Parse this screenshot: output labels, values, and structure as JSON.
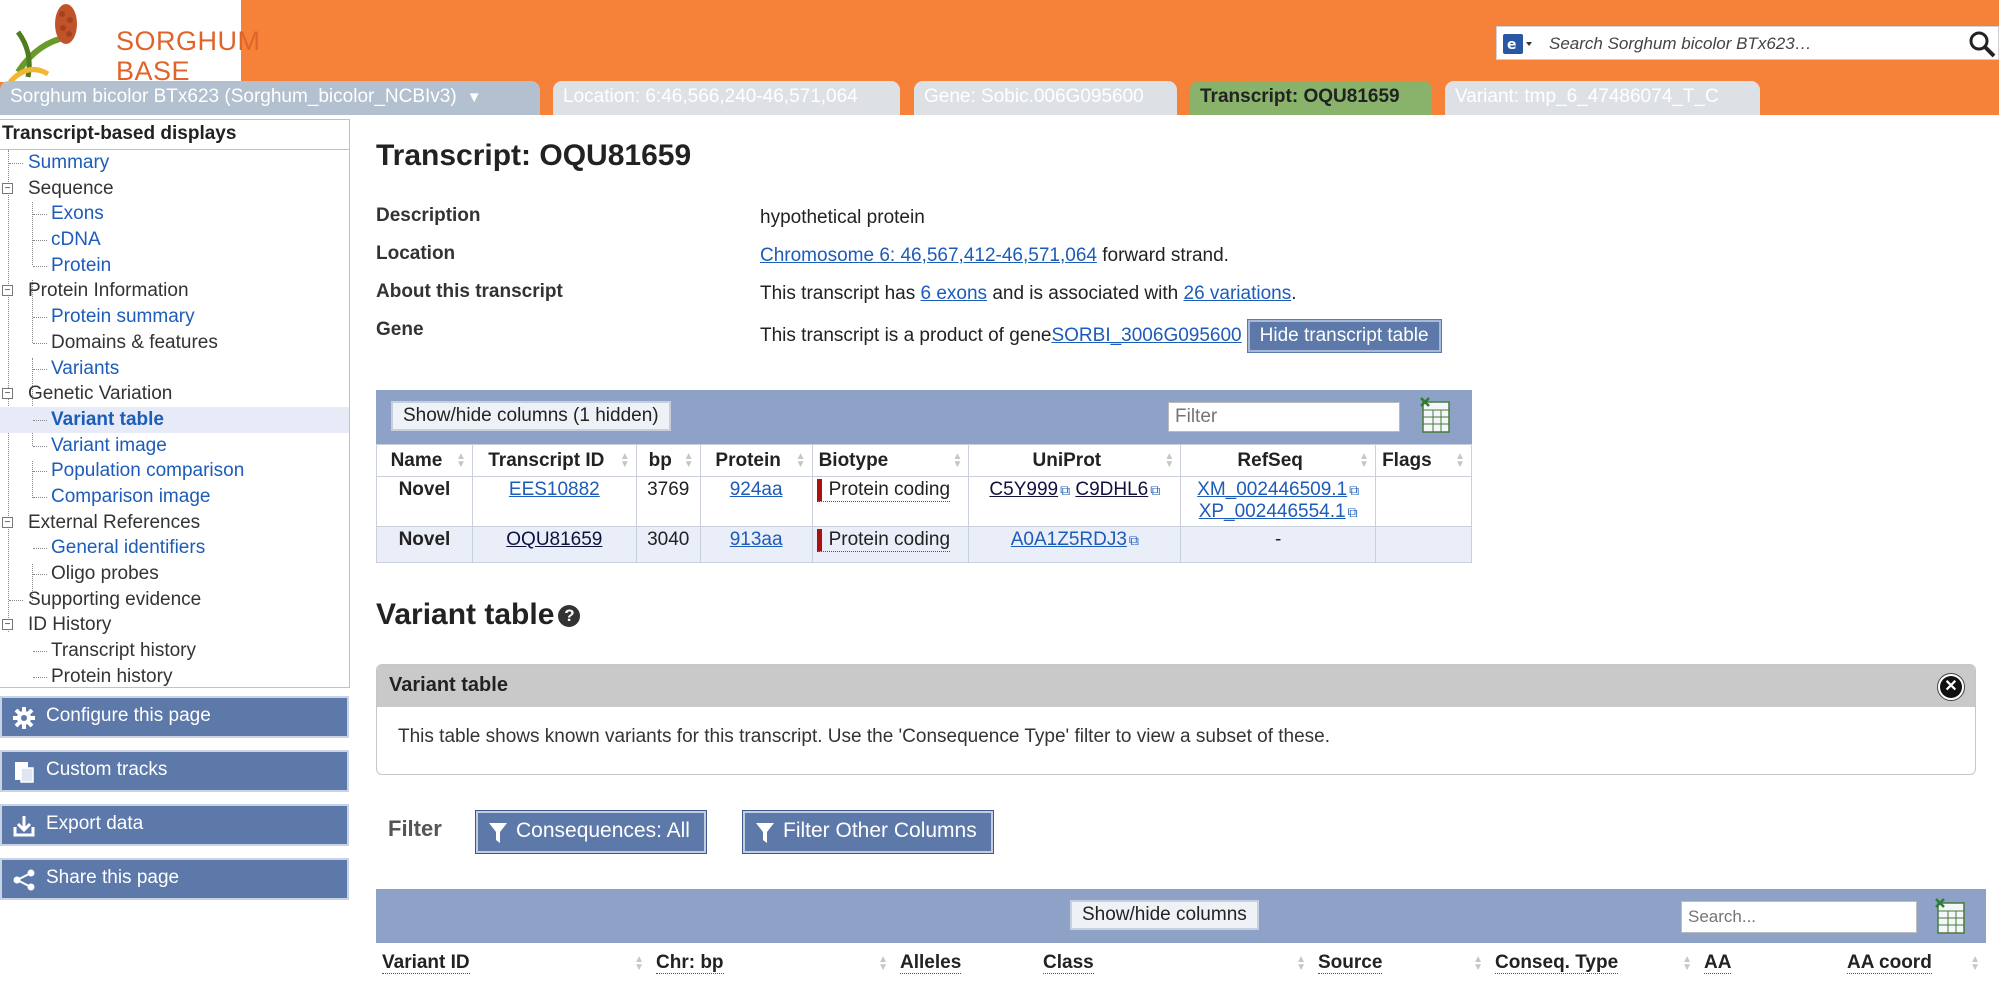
{
  "logo": {
    "line1": "SORGHUM",
    "line2": "BASE"
  },
  "search": {
    "placeholder": "Search Sorghum bicolor BTx623…"
  },
  "tabs": [
    {
      "label": "Sorghum bicolor BTx623 (Sorghum_bicolor_NCBIv3)",
      "caret": "▼"
    },
    {
      "label": "Location: 6:46,566,240-46,571,064"
    },
    {
      "label": "Gene: Sobic.006G095600"
    },
    {
      "label": "Transcript: OQU81659"
    },
    {
      "label": "Variant: tmp_6_47486074_T_C"
    }
  ],
  "sidebar": {
    "header": "Transcript-based displays",
    "tree": [
      {
        "label": "Summary"
      },
      {
        "label": "Sequence",
        "toggle": "−"
      },
      {
        "label": "Exons"
      },
      {
        "label": "cDNA"
      },
      {
        "label": "Protein"
      },
      {
        "label": "Protein Information",
        "toggle": "−"
      },
      {
        "label": "Protein summary"
      },
      {
        "label": "Domains & features"
      },
      {
        "label": "Variants"
      },
      {
        "label": "Genetic Variation",
        "toggle": "−"
      },
      {
        "label": "Variant table"
      },
      {
        "label": "Variant image"
      },
      {
        "label": "Population comparison"
      },
      {
        "label": "Comparison image"
      },
      {
        "label": "External References",
        "toggle": "−"
      },
      {
        "label": "General identifiers"
      },
      {
        "label": "Oligo probes"
      },
      {
        "label": "Supporting evidence"
      },
      {
        "label": "ID History",
        "toggle": "−"
      },
      {
        "label": "Transcript history"
      },
      {
        "label": "Protein history"
      }
    ],
    "buttons": {
      "configure": "Configure this page",
      "custom_tracks": "Custom tracks",
      "export": "Export data",
      "share": "Share this page"
    }
  },
  "main": {
    "title": "Transcript: OQU81659",
    "description": {
      "label": "Description",
      "value": "hypothetical protein"
    },
    "location": {
      "label": "Location",
      "link": "Chromosome 6: 46,567,412-46,571,064",
      "suffix": " forward strand."
    },
    "about": {
      "label": "About this transcript",
      "pre": "This transcript has ",
      "exons_link": "6 exons",
      "mid": " and is associated with ",
      "variations_link": "26 variations",
      "post": "."
    },
    "gene": {
      "label": "Gene",
      "pre": "This transcript is a product of gene ",
      "gene_link": "SORBI_3006G095600",
      "hide_button": "Hide transcript table"
    }
  },
  "transcript_table": {
    "show_hide": "Show/hide columns (1 hidden)",
    "filter_placeholder": "Filter",
    "headers": [
      "Name",
      "Transcript ID",
      "bp",
      "Protein",
      "Biotype",
      "UniProt",
      "RefSeq",
      "Flags"
    ],
    "rows": [
      {
        "name": "Novel",
        "transcript_id": "EES10882",
        "bp": "3769",
        "protein": "924aa",
        "biotype": "Protein coding",
        "uniprot": [
          "C5Y999",
          "C9DHL6"
        ],
        "refseq": [
          "XM_002446509.1",
          "XP_002446554.1"
        ],
        "flags": ""
      },
      {
        "name": "Novel",
        "transcript_id": "OQU81659",
        "bp": "3040",
        "protein": "913aa",
        "biotype": "Protein coding",
        "uniprot": [
          "A0A1Z5RDJ3"
        ],
        "refseq": [
          "-"
        ],
        "flags": ""
      }
    ]
  },
  "variant_section": {
    "title": "Variant table",
    "help_icon": "?",
    "panel_title": "Variant table",
    "panel_text": "This table shows known variants for this transcript. Use the 'Consequence Type' filter to view a subset of these.",
    "filter_label": "Filter",
    "consequences_button": "Consequences: All",
    "other_columns_button": "Filter Other Columns",
    "show_hide": "Show/hide columns",
    "search_placeholder": "Search...",
    "headers": [
      "Variant ID",
      "Chr: bp",
      "Alleles",
      "Class",
      "Source",
      "Conseq. Type",
      "AA",
      "AA coord"
    ]
  },
  "colors": {
    "masthead": "#f6823a",
    "active_tab": "#89b26b",
    "button": "#5d79aa",
    "table_bar": "#8ea2c8",
    "biotype_marker": "#aa1111"
  }
}
